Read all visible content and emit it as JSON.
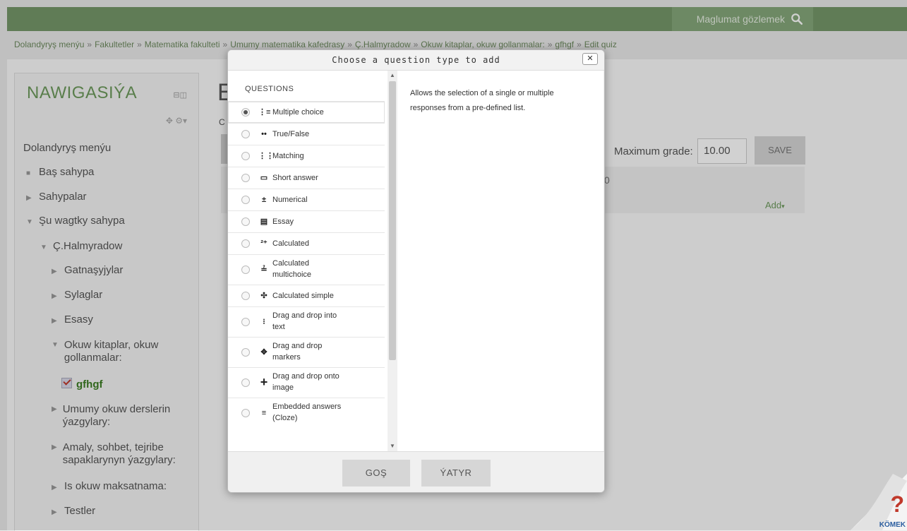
{
  "header": {
    "search_label": "Maglumat gözlemek"
  },
  "breadcrumb": [
    "Dolandyryş menýu",
    "Fakultetler",
    "Matematika fakulteti",
    "Umumy matematika kafedrasy",
    "Ç.Halmyradow",
    "Okuw kitaplar, okuw gollanmalar:",
    "gfhgf",
    "Edit quiz"
  ],
  "breadcrumb_sep": "»",
  "nav": {
    "title": "NAWIGASIÝA",
    "items": [
      "Dolandyryş menýu",
      "Baş sahypa",
      "Sahypalar",
      "Şu wagtky sahypa",
      "Ç.Halmyradow",
      "Gatnaşyjylar",
      "Sylaglar",
      "Esasy",
      "Okuw kitaplar, okuw gollanmalar:",
      "gfhgf",
      "Umumy okuw derslerin ýazgylary:",
      "Amaly, sohbet, tejribe sapaklarynyn ýazgylary:",
      "Is okuw maksatnama:",
      "Testler"
    ]
  },
  "main": {
    "heading_partial": "E",
    "sub_partial": "C",
    "max_grade_label": "Maximum grade:",
    "max_grade_value": "10.00",
    "save_label": "SAVE",
    "zero": "0",
    "add_label": "Add"
  },
  "dialog": {
    "title": "Choose a question type to add",
    "close": "✕",
    "section_label": "QUESTIONS",
    "options": [
      {
        "label": "Multiple choice",
        "icon": "multiple-choice-icon",
        "glyph": "⋮≡",
        "selected": true
      },
      {
        "label": "True/False",
        "icon": "true-false-icon",
        "glyph": "••",
        "selected": false
      },
      {
        "label": "Matching",
        "icon": "matching-icon",
        "glyph": "⋮⋮",
        "selected": false
      },
      {
        "label": "Short answer",
        "icon": "short-answer-icon",
        "glyph": "▭",
        "selected": false
      },
      {
        "label": "Numerical",
        "icon": "numerical-icon",
        "glyph": "±",
        "selected": false
      },
      {
        "label": "Essay",
        "icon": "essay-icon",
        "glyph": "▤",
        "selected": false
      },
      {
        "label": "Calculated",
        "icon": "calculated-icon",
        "glyph": "²⁺",
        "selected": false
      },
      {
        "label": "Calculated multichoice",
        "icon": "calculated-multichoice-icon",
        "glyph": "≟",
        "selected": false
      },
      {
        "label": "Calculated simple",
        "icon": "calculated-simple-icon",
        "glyph": "✣",
        "selected": false
      },
      {
        "label": "Drag and drop into text",
        "icon": "drag-drop-text-icon",
        "glyph": "⁝",
        "selected": false
      },
      {
        "label": "Drag and drop markers",
        "icon": "drag-drop-markers-icon",
        "glyph": "✥",
        "selected": false
      },
      {
        "label": "Drag and drop onto image",
        "icon": "drag-drop-image-icon",
        "glyph": "+",
        "selected": false
      },
      {
        "label": "Embedded answers (Cloze)",
        "icon": "embedded-answers-icon",
        "glyph": "≡",
        "selected": false
      }
    ],
    "description": "Allows the selection of a single or multiple responses from a pre-defined list.",
    "add_button": "GOŞ",
    "cancel_button": "ÝATYR"
  },
  "help": {
    "label": "KÖMEK",
    "glyph": "?"
  },
  "colors": {
    "brand_green": "#76986a",
    "link_green": "#6d9a5c"
  }
}
